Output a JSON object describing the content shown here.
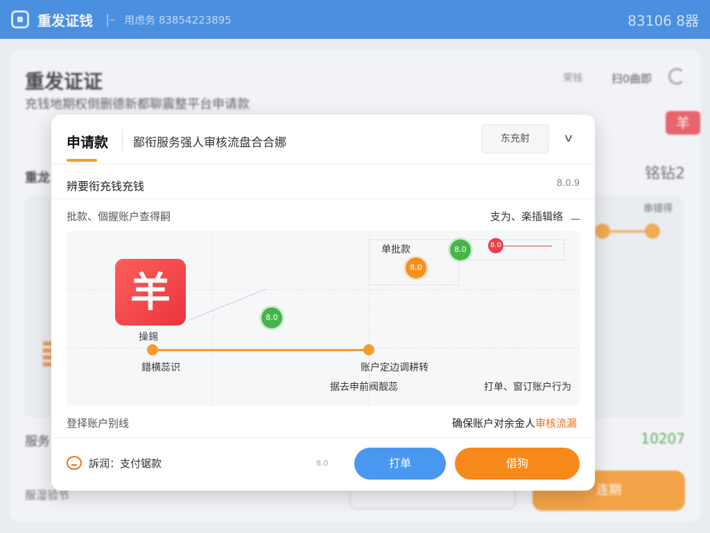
{
  "topbar": {
    "app_title": "重发证钱",
    "separator": "|–",
    "hotline": "用虑务 83854223895",
    "right_text": "83106 8器"
  },
  "background": {
    "title": "重发证证",
    "subtitle": "充钱地期权倒删德新都聊震整平台申请款",
    "link1": "荣钱",
    "link2": "扫0曲即",
    "badge": "羊",
    "section": "重龙",
    "section_right": "铭钻2",
    "steps_label": "串错得",
    "row_label": "服务",
    "row_value": "10207",
    "footer_text": "服湿验节",
    "footer_button": "连期"
  },
  "modal": {
    "title": "申请款",
    "subtitle": "鄙衔服务强人审核流盘合合娜",
    "action_button": "东充射",
    "chevron": "chevron-down-icon",
    "row1": {
      "left": "辨要衔充钱充钱",
      "right": "8.0.9"
    },
    "row2": {
      "left": "批款、個握账户查得嗣",
      "right": "支为、楽插辑络"
    },
    "diagram": {
      "logo_glyph": "羊",
      "logo_caption": "操錫",
      "label_left": "錯横蕊识",
      "label_mid": "账户定边调耕转",
      "label_bottom_mid": "据去申前阀靓蕊",
      "label_bottom_right": "打单、窗订账户行为",
      "label_top": "单批款",
      "node_green_mid": "8.0",
      "node_green_top": "8.0",
      "node_orange_top": "8.0",
      "node_red": "8.0"
    },
    "row3": {
      "left": "登择账户别线",
      "right_prefix": "确保账户对余金人",
      "right_accent": "审核流漏"
    },
    "footer": {
      "method_label": "訴润：支付锯款",
      "small_text": "8.0",
      "button_blue": "打单",
      "button_orange": "借狗"
    }
  },
  "colors": {
    "topbar": "#4a8fe0",
    "accent_orange": "#f7891a",
    "accent_blue": "#4a97ef",
    "success_green": "#45b649",
    "danger_red": "#e9414c"
  }
}
